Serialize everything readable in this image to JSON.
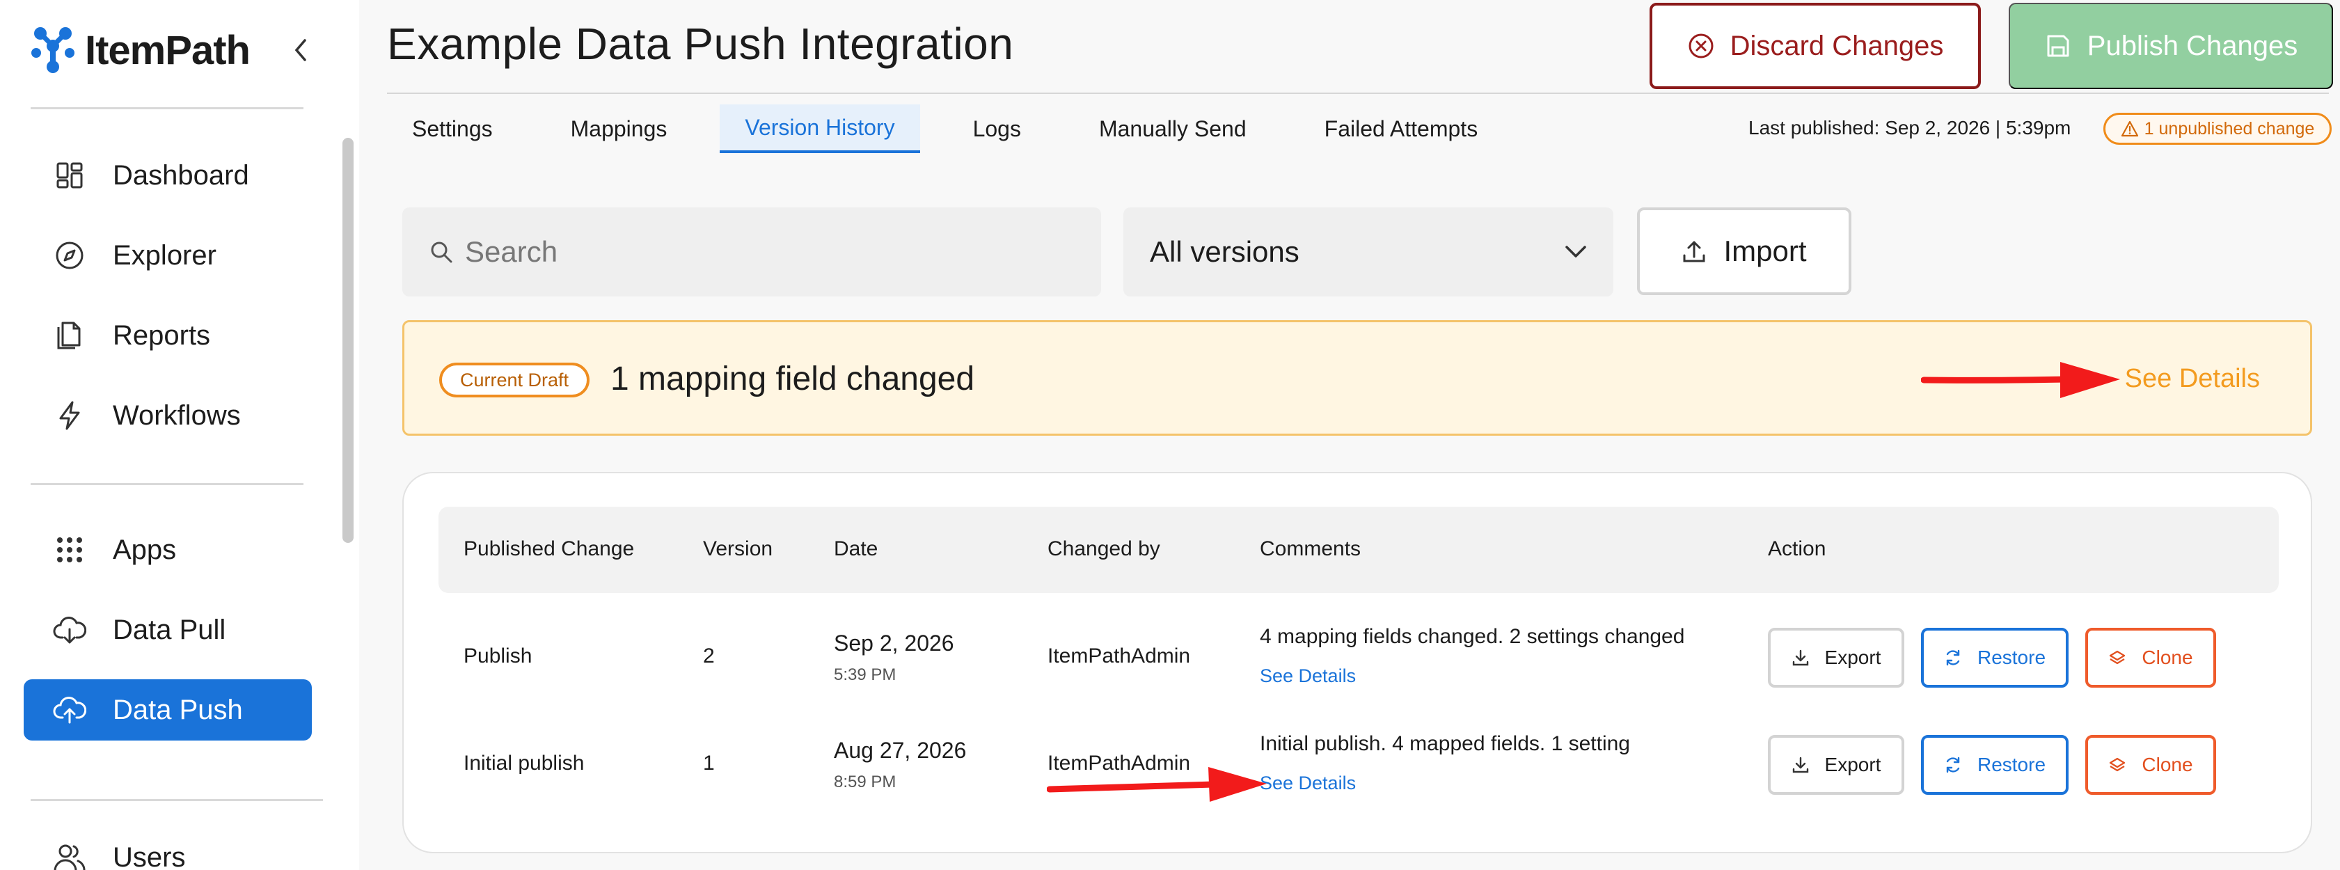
{
  "sidebar": {
    "brand": "ItemPath",
    "items": [
      {
        "label": "Dashboard",
        "icon": "dashboard-icon"
      },
      {
        "label": "Explorer",
        "icon": "compass-icon"
      },
      {
        "label": "Reports",
        "icon": "document-icon"
      },
      {
        "label": "Workflows",
        "icon": "lightning-icon"
      },
      {
        "label": "Apps",
        "icon": "grid-dots-icon"
      },
      {
        "label": "Data Pull",
        "icon": "cloud-download-icon"
      },
      {
        "label": "Data Push",
        "icon": "cloud-upload-icon",
        "active": true
      },
      {
        "label": "Users",
        "icon": "users-icon"
      }
    ]
  },
  "header": {
    "title": "Example Data Push Integration",
    "discard_label": "Discard Changes",
    "publish_label": "Publish Changes"
  },
  "tabs": [
    {
      "label": "Settings"
    },
    {
      "label": "Mappings"
    },
    {
      "label": "Version History",
      "active": true
    },
    {
      "label": "Logs"
    },
    {
      "label": "Manually Send"
    },
    {
      "label": "Failed Attempts"
    }
  ],
  "status": {
    "last_published": "Last published: Sep 2, 2026 | 5:39pm",
    "unpublished": "1 unpublished change"
  },
  "toolbar": {
    "search_placeholder": "Search",
    "version_filter": "All versions",
    "import_label": "Import"
  },
  "draft": {
    "badge": "Current Draft",
    "summary": "1 mapping field changed",
    "details_link": "See Details"
  },
  "table": {
    "headers": [
      "Published Change",
      "Version",
      "Date",
      "Changed by",
      "Comments",
      "Action"
    ],
    "rows": [
      {
        "change": "Publish",
        "version": "2",
        "date": "Sep 2, 2026",
        "time": "5:39 PM",
        "changed_by": "ItemPathAdmin",
        "comment": "4 mapping fields changed. 2 settings changed",
        "details_link": "See Details"
      },
      {
        "change": "Initial publish",
        "version": "1",
        "date": "Aug 27, 2026",
        "time": "8:59 PM",
        "changed_by": "ItemPathAdmin",
        "comment": "Initial publish. 4 mapped fields. 1 setting",
        "details_link": "See Details"
      }
    ],
    "actions": {
      "export": "Export",
      "restore": "Restore",
      "clone": "Clone"
    }
  },
  "colors": {
    "accent": "#1a73d9",
    "discard": "#9a1d1d",
    "publish_disabled": "#92cfa0",
    "warning": "#f08c1a",
    "clone": "#ef5b2b",
    "annotation_arrow": "#f21b1b"
  }
}
